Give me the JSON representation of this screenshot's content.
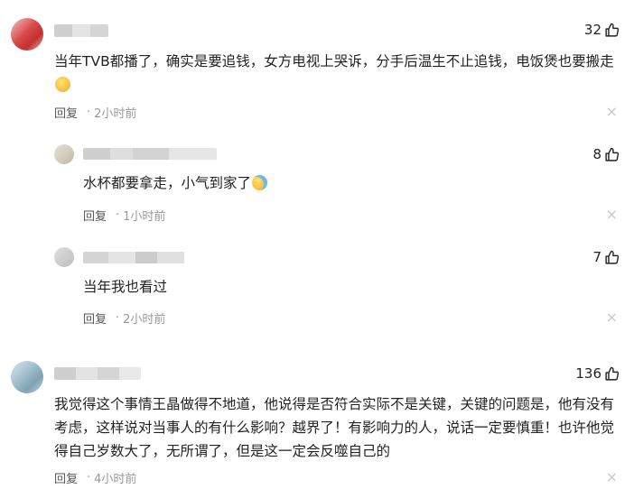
{
  "comments": [
    {
      "likes": "32",
      "text": "当年TVB都播了，确实是要追钱，女方电视上哭诉，分手后温生不止追钱，电饭煲也要搬走",
      "reply_label": "回复",
      "time": "2小时前",
      "emoji": "grin-face-icon"
    },
    {
      "likes": "8",
      "text": "水杯都要拿走，小气到家了",
      "reply_label": "回复",
      "time": "1小时前",
      "emoji": "laugh-cry-face-icon"
    },
    {
      "likes": "7",
      "text": "当年我也看过",
      "reply_label": "回复",
      "time": "2小时前"
    },
    {
      "likes": "136",
      "text": "我觉得这个事情王晶做得不地道，他说得是否符合实际不是关键，关键的问题是，他有没有考虑，这样说对当事人的有什么影响？越界了！有影响力的人，说话一定要慎重！也许他觉得自己岁数大了，无所谓了，但是这一定会反噬自己的",
      "reply_label": "回复",
      "time": "4小时前"
    }
  ],
  "close_glyph": "×",
  "time_separator": "·",
  "colors": {
    "text": "#222222",
    "meta": "#999999",
    "close": "#c8c8c8"
  }
}
